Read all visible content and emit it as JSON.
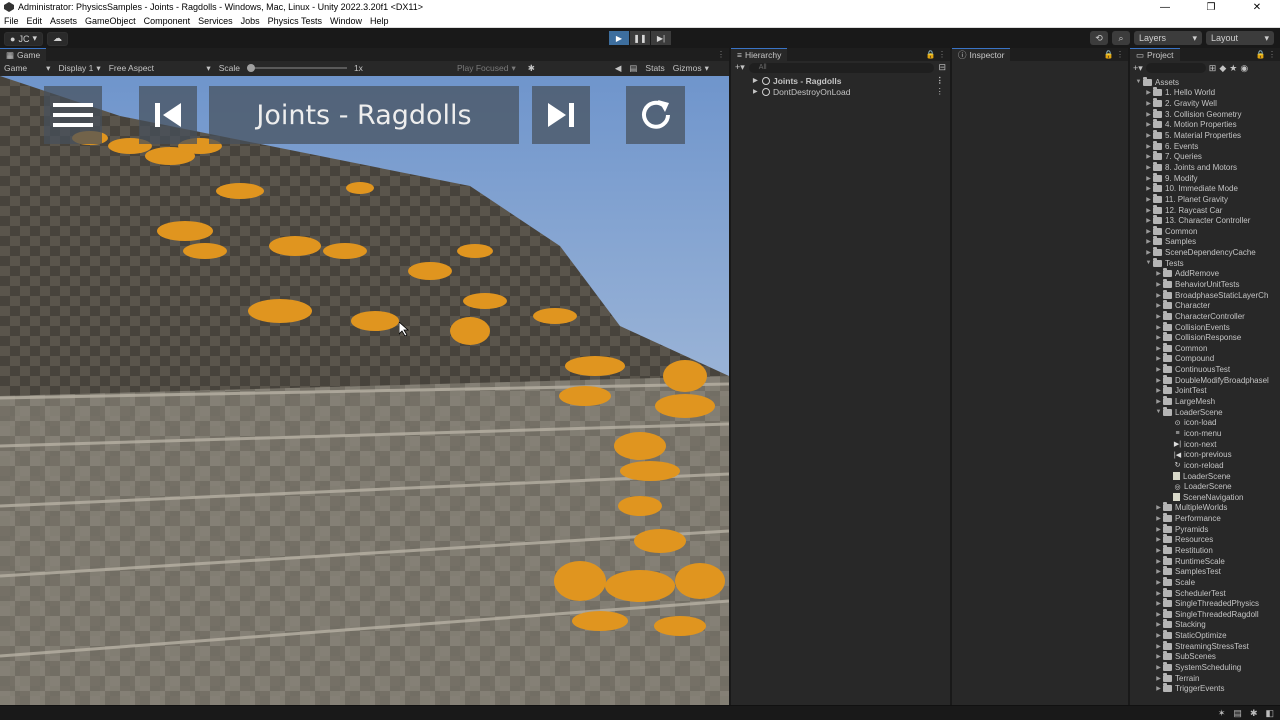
{
  "window": {
    "title": "Administrator: PhysicsSamples - Joints - Ragdolls - Windows, Mac, Linux - Unity 2022.3.20f1 <DX11>",
    "controls": [
      "—",
      "❐",
      "✕"
    ]
  },
  "menu": [
    "File",
    "Edit",
    "Assets",
    "GameObject",
    "Component",
    "Services",
    "Jobs",
    "Physics Tests",
    "Window",
    "Help"
  ],
  "toolbar": {
    "account": "JC",
    "layers_label": "Layers",
    "layout_label": "Layout"
  },
  "game": {
    "tab": "Game",
    "mode": "Game",
    "display": "Display 1",
    "aspect": "Free Aspect",
    "scale_label": "Scale",
    "scale_value": "1x",
    "play_focused": "Play Focused",
    "stats": "Stats",
    "gizmos": "Gizmos",
    "overlay_title": "Joints - Ragdolls"
  },
  "hierarchy": {
    "tab": "Hierarchy",
    "search_placeholder": "All",
    "items": [
      "Joints - Ragdolls",
      "DontDestroyOnLoad"
    ]
  },
  "inspector": {
    "tab": "Inspector"
  },
  "project": {
    "tab": "Project",
    "tree": [
      {
        "label": "Assets",
        "depth": 0,
        "type": "folder-open"
      },
      {
        "label": "1. Hello World",
        "depth": 1,
        "type": "folder"
      },
      {
        "label": "2. Gravity Well",
        "depth": 1,
        "type": "folder"
      },
      {
        "label": "3. Collision Geometry",
        "depth": 1,
        "type": "folder"
      },
      {
        "label": "4. Motion Properties",
        "depth": 1,
        "type": "folder"
      },
      {
        "label": "5. Material Properties",
        "depth": 1,
        "type": "folder"
      },
      {
        "label": "6. Events",
        "depth": 1,
        "type": "folder"
      },
      {
        "label": "7. Queries",
        "depth": 1,
        "type": "folder"
      },
      {
        "label": "8. Joints and Motors",
        "depth": 1,
        "type": "folder"
      },
      {
        "label": "9. Modify",
        "depth": 1,
        "type": "folder"
      },
      {
        "label": "10. Immediate Mode",
        "depth": 1,
        "type": "folder"
      },
      {
        "label": "11. Planet Gravity",
        "depth": 1,
        "type": "folder"
      },
      {
        "label": "12. Raycast Car",
        "depth": 1,
        "type": "folder"
      },
      {
        "label": "13. Character Controller",
        "depth": 1,
        "type": "folder"
      },
      {
        "label": "Common",
        "depth": 1,
        "type": "folder"
      },
      {
        "label": "Samples",
        "depth": 1,
        "type": "folder"
      },
      {
        "label": "SceneDependencyCache",
        "depth": 1,
        "type": "folder"
      },
      {
        "label": "Tests",
        "depth": 1,
        "type": "folder-open"
      },
      {
        "label": "AddRemove",
        "depth": 2,
        "type": "folder"
      },
      {
        "label": "BehaviorUnitTests",
        "depth": 2,
        "type": "folder"
      },
      {
        "label": "BroadphaseStaticLayerCh",
        "depth": 2,
        "type": "folder"
      },
      {
        "label": "Character",
        "depth": 2,
        "type": "folder"
      },
      {
        "label": "CharacterController",
        "depth": 2,
        "type": "folder"
      },
      {
        "label": "CollisionEvents",
        "depth": 2,
        "type": "folder"
      },
      {
        "label": "CollisionResponse",
        "depth": 2,
        "type": "folder"
      },
      {
        "label": "Common",
        "depth": 2,
        "type": "folder"
      },
      {
        "label": "Compound",
        "depth": 2,
        "type": "folder"
      },
      {
        "label": "ContinuousTest",
        "depth": 2,
        "type": "folder"
      },
      {
        "label": "DoubleModifyBroadphasel",
        "depth": 2,
        "type": "folder"
      },
      {
        "label": "JointTest",
        "depth": 2,
        "type": "folder"
      },
      {
        "label": "LargeMesh",
        "depth": 2,
        "type": "folder"
      },
      {
        "label": "LoaderScene",
        "depth": 2,
        "type": "folder-open"
      },
      {
        "label": "icon-load",
        "depth": 3,
        "type": "icon-load"
      },
      {
        "label": "icon-menu",
        "depth": 3,
        "type": "icon-menu"
      },
      {
        "label": "icon-next",
        "depth": 3,
        "type": "icon-next"
      },
      {
        "label": "icon-previous",
        "depth": 3,
        "type": "icon-previous"
      },
      {
        "label": "icon-reload",
        "depth": 3,
        "type": "icon-reload"
      },
      {
        "label": "LoaderScene",
        "depth": 3,
        "type": "file"
      },
      {
        "label": "LoaderScene",
        "depth": 3,
        "type": "scene"
      },
      {
        "label": "SceneNavigation",
        "depth": 3,
        "type": "file"
      },
      {
        "label": "MultipleWorlds",
        "depth": 2,
        "type": "folder"
      },
      {
        "label": "Performance",
        "depth": 2,
        "type": "folder"
      },
      {
        "label": "Pyramids",
        "depth": 2,
        "type": "folder"
      },
      {
        "label": "Resources",
        "depth": 2,
        "type": "folder"
      },
      {
        "label": "Restitution",
        "depth": 2,
        "type": "folder"
      },
      {
        "label": "RuntimeScale",
        "depth": 2,
        "type": "folder"
      },
      {
        "label": "SamplesTest",
        "depth": 2,
        "type": "folder"
      },
      {
        "label": "Scale",
        "depth": 2,
        "type": "folder"
      },
      {
        "label": "SchedulerTest",
        "depth": 2,
        "type": "folder"
      },
      {
        "label": "SingleThreadedPhysics",
        "depth": 2,
        "type": "folder"
      },
      {
        "label": "SingleThreadedRagdoll",
        "depth": 2,
        "type": "folder"
      },
      {
        "label": "Stacking",
        "depth": 2,
        "type": "folder"
      },
      {
        "label": "StaticOptimize",
        "depth": 2,
        "type": "folder"
      },
      {
        "label": "StreamingStressTest",
        "depth": 2,
        "type": "folder"
      },
      {
        "label": "SubScenes",
        "depth": 2,
        "type": "folder"
      },
      {
        "label": "SystemScheduling",
        "depth": 2,
        "type": "folder"
      },
      {
        "label": "Terrain",
        "depth": 2,
        "type": "folder"
      },
      {
        "label": "TriggerEvents",
        "depth": 2,
        "type": "folder"
      }
    ]
  },
  "colors": {
    "accent": "#3d6e9e",
    "ragdoll": "#e0951f",
    "sky": "#8fb3de",
    "floor": "#7a756b"
  }
}
